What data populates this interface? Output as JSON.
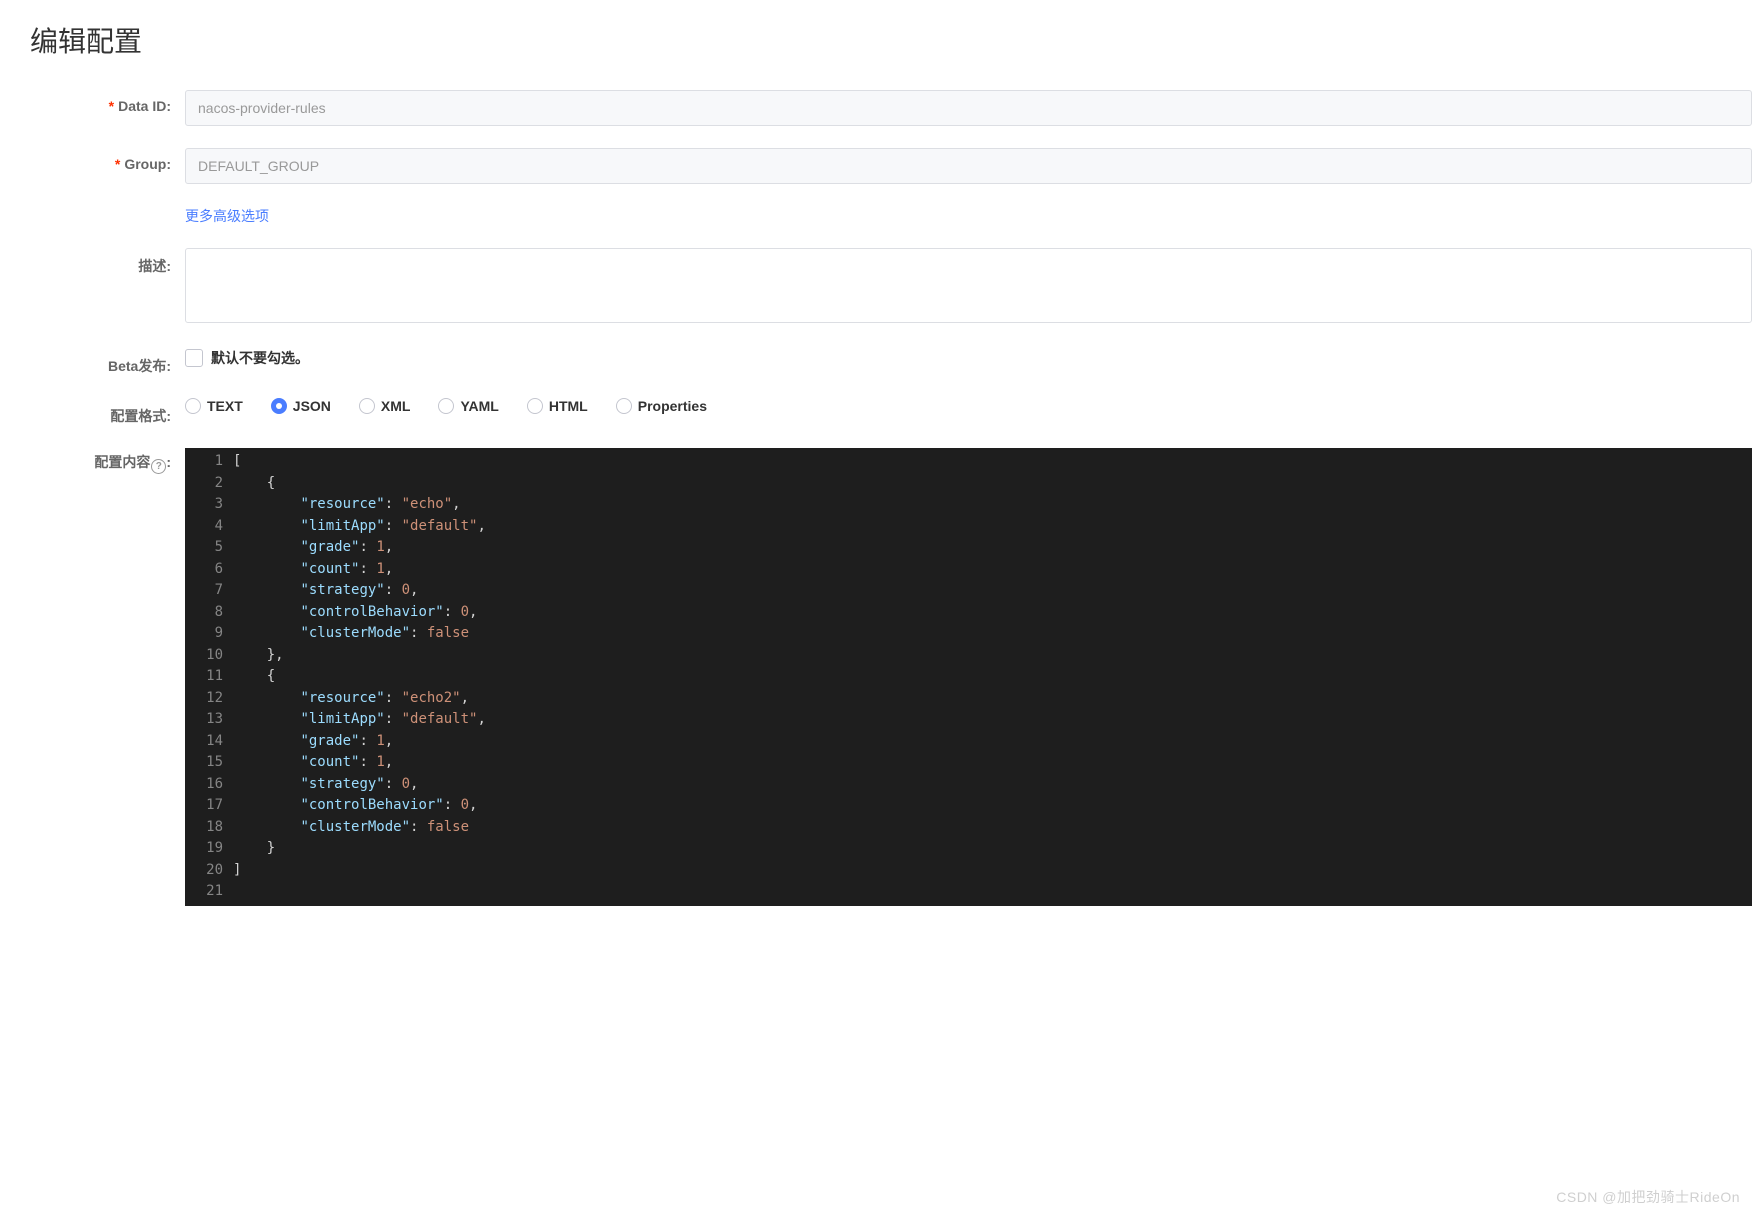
{
  "page": {
    "title": "编辑配置"
  },
  "form": {
    "data_id": {
      "label": "Data ID:",
      "value": "nacos-provider-rules"
    },
    "group": {
      "label": "Group:",
      "value": "DEFAULT_GROUP"
    },
    "more_link": "更多高级选项",
    "desc": {
      "label": "描述:",
      "value": ""
    },
    "beta": {
      "label": "Beta发布:",
      "hint": "默认不要勾选。"
    },
    "format": {
      "label": "配置格式:",
      "options": [
        "TEXT",
        "JSON",
        "XML",
        "YAML",
        "HTML",
        "Properties"
      ],
      "selected": "JSON"
    },
    "content": {
      "label": "配置内容",
      "help": "?"
    }
  },
  "editor": {
    "line_count": 21,
    "code_rules": [
      {
        "resource": "echo",
        "limitApp": "default",
        "grade": 1,
        "count": 1,
        "strategy": 0,
        "controlBehavior": 0,
        "clusterMode": false
      },
      {
        "resource": "echo2",
        "limitApp": "default",
        "grade": 1,
        "count": 1,
        "strategy": 0,
        "controlBehavior": 0,
        "clusterMode": false
      }
    ]
  },
  "watermark": "CSDN @加把劲骑士RideOn"
}
